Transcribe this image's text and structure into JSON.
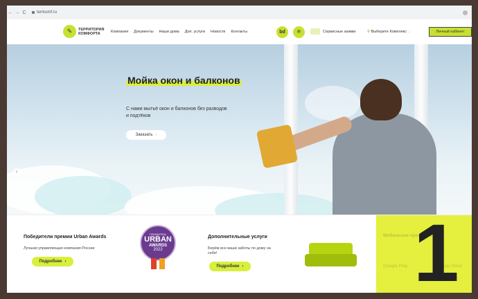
{
  "browser": {
    "back": "←",
    "forward": "→",
    "reload": "C",
    "url": "terrkomf.ru"
  },
  "header": {
    "logo_line1": "ТЕРРИТОРИЯ",
    "logo_line2": "КОМФОРТА",
    "menu": [
      "Компания",
      "Документы",
      "Наши дома",
      "Доп. услуги",
      "Новости",
      "Контакты"
    ],
    "icon1": "bd",
    "icon2": "℗",
    "service_requests": "Сервисные заявки",
    "choose_complex": "Выберите Комплекс",
    "cabinet": "Личный кабинет"
  },
  "hero": {
    "title": "Мойка окон и балконов",
    "subtitle": "С нами мытьё окон и балконов без разводов и подтёков",
    "order_button": "Заказать",
    "arrow": "›",
    "prev": "‹"
  },
  "cards": {
    "awards": {
      "title": "Победители премии Urban Awards",
      "text": "Лучшая управляющая компания России",
      "button": "Подробнее",
      "badge_top": "ПОБЕДИТЕЛЬ",
      "badge_urban": "URBAN",
      "badge_awards": "AWARDS",
      "badge_year": "2022"
    },
    "services": {
      "title": "Дополнительные услуги",
      "text": "Берём все ваши заботы по дому на себя!",
      "button": "Подробнее"
    },
    "mobile": {
      "title": "Мобильное приложение",
      "google": "Google Play",
      "apple": "App Store"
    }
  },
  "overlay_number": "1",
  "colors": {
    "accent": "#c8e031",
    "highlight": "#e5ef3d",
    "frame": "#4a3a33"
  }
}
